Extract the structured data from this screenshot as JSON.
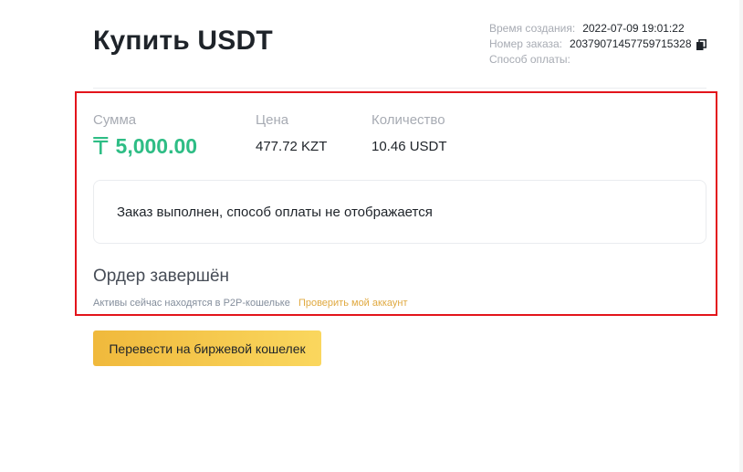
{
  "header": {
    "title": "Купить USDT"
  },
  "meta": {
    "created_label": "Время создания:",
    "created_value": "2022-07-09 19:01:22",
    "order_label": "Номер заказа:",
    "order_value": "20379071457759715328",
    "payment_label": "Способ оплаты:",
    "payment_value": ""
  },
  "summary": {
    "amount_label": "Сумма",
    "amount_currency_symbol": "₸",
    "amount_value": "5,000.00",
    "price_label": "Цена",
    "price_value": "477.72 KZT",
    "quantity_label": "Количество",
    "quantity_value": "10.46 USDT"
  },
  "notice": {
    "text": "Заказ выполнен, способ оплаты не отображается"
  },
  "status": {
    "title": "Ордер завершён",
    "note": "Активы сейчас находятся в P2P-кошельке",
    "link_label": "Проверить мой аккаунт"
  },
  "actions": {
    "transfer_label": "Перевести на биржевой кошелек"
  },
  "colors": {
    "amount": "#2ebd85",
    "link": "#e0a940",
    "button_start": "#f0b93c",
    "button_end": "#fad75e",
    "highlight_border": "#e3141b"
  },
  "icons": {
    "copy": "copy-icon",
    "currency": "tenge-icon"
  }
}
